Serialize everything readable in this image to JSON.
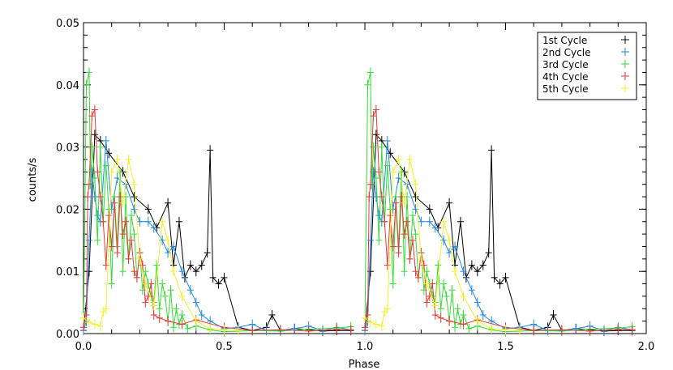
{
  "chart_data": {
    "type": "line",
    "title": "",
    "xlabel": "Phase",
    "ylabel": "counts/s",
    "xlim": [
      0.0,
      2.0
    ],
    "ylim": [
      0.0,
      0.05
    ],
    "x_ticks": [
      "0.0",
      "0.5",
      "1.0",
      "1.5",
      "2.0"
    ],
    "x_tick_values": [
      0.0,
      0.5,
      1.0,
      1.5,
      2.0
    ],
    "y_ticks": [
      "0.00",
      "0.01",
      "0.02",
      "0.03",
      "0.04",
      "0.05"
    ],
    "y_tick_values": [
      0.0,
      0.01,
      0.02,
      0.03,
      0.04,
      0.05
    ],
    "grid": false,
    "legend_position": "top-right",
    "series": [
      {
        "name": "1st Cycle",
        "color": "#000000",
        "x": [
          0.0,
          0.02,
          0.04,
          0.06,
          0.09,
          0.14,
          0.18,
          0.23,
          0.26,
          0.3,
          0.32,
          0.34,
          0.36,
          0.38,
          0.4,
          0.42,
          0.44,
          0.45,
          0.46,
          0.48,
          0.5,
          0.55,
          0.6,
          0.65,
          0.67,
          0.7,
          0.75,
          0.8,
          0.85,
          0.9,
          0.95
        ],
        "y": [
          0.0005,
          0.01,
          0.032,
          0.031,
          0.029,
          0.026,
          0.022,
          0.02,
          0.017,
          0.021,
          0.011,
          0.018,
          0.009,
          0.011,
          0.01,
          0.011,
          0.013,
          0.0295,
          0.009,
          0.008,
          0.009,
          0.001,
          0.0005,
          0.001,
          0.003,
          0.0005,
          0.0008,
          0.0006,
          0.0004,
          0.0005,
          0.0005
        ]
      },
      {
        "name": "2nd Cycle",
        "color": "#1e88e5",
        "x": [
          0.0,
          0.01,
          0.02,
          0.03,
          0.04,
          0.05,
          0.06,
          0.08,
          0.1,
          0.12,
          0.15,
          0.18,
          0.2,
          0.23,
          0.25,
          0.28,
          0.3,
          0.32,
          0.35,
          0.38,
          0.4,
          0.42,
          0.45,
          0.5,
          0.55,
          0.6,
          0.65,
          0.7,
          0.75,
          0.8,
          0.85,
          0.9,
          0.95
        ],
        "y": [
          0.0005,
          0.002,
          0.015,
          0.026,
          0.022,
          0.019,
          0.018,
          0.031,
          0.02,
          0.025,
          0.024,
          0.02,
          0.018,
          0.018,
          0.017,
          0.015,
          0.013,
          0.014,
          0.01,
          0.007,
          0.005,
          0.003,
          0.002,
          0.0008,
          0.001,
          0.0015,
          0.0005,
          0.0004,
          0.0008,
          0.0012,
          0.0005,
          0.001,
          0.0006
        ]
      },
      {
        "name": "3rd Cycle",
        "color": "#33dd33",
        "x": [
          0.0,
          0.01,
          0.02,
          0.025,
          0.03,
          0.04,
          0.05,
          0.06,
          0.07,
          0.08,
          0.09,
          0.1,
          0.11,
          0.12,
          0.13,
          0.14,
          0.15,
          0.16,
          0.17,
          0.18,
          0.19,
          0.2,
          0.21,
          0.22,
          0.23,
          0.24,
          0.25,
          0.26,
          0.27,
          0.28,
          0.29,
          0.3,
          0.31,
          0.32,
          0.33,
          0.34,
          0.35,
          0.37,
          0.4,
          0.45,
          0.5,
          0.6,
          0.7,
          0.8,
          0.9,
          0.95
        ],
        "y": [
          0.001,
          0.04,
          0.042,
          0.024,
          0.03,
          0.025,
          0.015,
          0.03,
          0.018,
          0.027,
          0.02,
          0.008,
          0.022,
          0.014,
          0.026,
          0.01,
          0.022,
          0.012,
          0.019,
          0.016,
          0.009,
          0.013,
          0.007,
          0.01,
          0.008,
          0.006,
          0.005,
          0.011,
          0.004,
          0.008,
          0.006,
          0.002,
          0.007,
          0.001,
          0.004,
          0.0015,
          0.003,
          0.0008,
          0.0012,
          0.0006,
          0.0003,
          0.0005,
          0.0004,
          0.0007,
          0.0009,
          0.0011
        ]
      },
      {
        "name": "4th Cycle",
        "color": "#e53935",
        "x": [
          0.0,
          0.01,
          0.015,
          0.02,
          0.03,
          0.04,
          0.05,
          0.06,
          0.07,
          0.08,
          0.09,
          0.1,
          0.11,
          0.12,
          0.13,
          0.14,
          0.15,
          0.16,
          0.17,
          0.18,
          0.19,
          0.2,
          0.21,
          0.22,
          0.23,
          0.24,
          0.25,
          0.27,
          0.3,
          0.35,
          0.4,
          0.5,
          0.6,
          0.7,
          0.8,
          0.9,
          0.95
        ],
        "y": [
          0.001,
          0.003,
          0.022,
          0.024,
          0.035,
          0.036,
          0.026,
          0.022,
          0.018,
          0.011,
          0.019,
          0.014,
          0.021,
          0.013,
          0.022,
          0.016,
          0.018,
          0.012,
          0.015,
          0.01,
          0.009,
          0.013,
          0.011,
          0.005,
          0.006,
          0.008,
          0.003,
          0.0025,
          0.002,
          0.0015,
          0.0022,
          0.001,
          0.0005,
          0.0006,
          0.0004,
          0.0007,
          0.0006
        ]
      },
      {
        "name": "5th Cycle",
        "color": "#f5ef2a",
        "x": [
          0.0,
          0.02,
          0.04,
          0.06,
          0.07,
          0.08,
          0.1,
          0.12,
          0.14,
          0.16,
          0.18,
          0.2,
          0.22,
          0.25,
          0.28,
          0.3,
          0.32,
          0.35,
          0.4,
          0.45,
          0.5,
          0.55
        ],
        "y": [
          0.0025,
          0.0018,
          0.0015,
          0.0012,
          0.0035,
          0.004,
          0.026,
          0.028,
          0.021,
          0.028,
          0.024,
          0.012,
          0.008,
          0.0045,
          0.018,
          0.015,
          0.01,
          0.006,
          0.002,
          0.0008,
          0.0006,
          0.0005
        ]
      }
    ]
  }
}
